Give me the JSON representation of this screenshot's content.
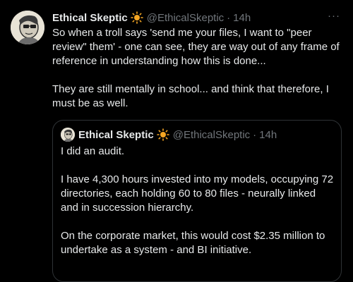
{
  "tweet": {
    "author_name": "Ethical Skeptic",
    "author_handle": "@EthicalSkeptic",
    "separator": "·",
    "time": "14h",
    "more_label": "···",
    "badge_icon": "sun-icon",
    "paragraphs": [
      "So when a troll says 'send me your files, I want to \"peer review\" them' - one can see, they are way out of any frame of reference in understanding how this is done...",
      "They are still mentally in school... and think that therefore, I must be as well."
    ]
  },
  "quoted_tweet": {
    "author_name": "Ethical Skeptic",
    "author_handle": "@EthicalSkeptic",
    "separator": "·",
    "time": "14h",
    "badge_icon": "sun-icon",
    "paragraphs": [
      "I did an audit.",
      "I have 4,300 hours invested into my models, occupying 72 directories, each holding 60 to 80 files - neurally linked and in succession hierarchy.",
      "On the corporate market, this would cost $2.35 million to undertake as a system - and BI initiative."
    ]
  },
  "colors": {
    "background": "#000000",
    "text": "#e7e9ea",
    "muted": "#71767b",
    "border": "#2f3336",
    "sun": "#f5a623"
  }
}
